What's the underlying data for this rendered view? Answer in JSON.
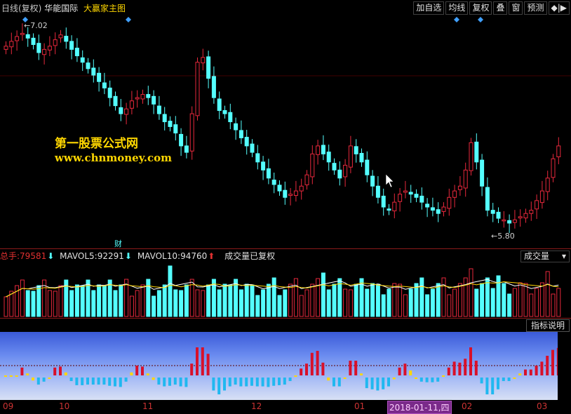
{
  "title": {
    "period": "日线(复权)",
    "stock": "华能国际",
    "indicator": "大赢家主图"
  },
  "toolbar": {
    "buttons": [
      "加自选",
      "均线",
      "复权",
      "叠",
      "窗",
      "预测",
      "◆|▶"
    ]
  },
  "price": {
    "high_label": "7.02",
    "low_label": "5.80",
    "marker": "财"
  },
  "watermark": {
    "line1": "第一股票公式网",
    "line2": "www.chnmoney.com"
  },
  "volume": {
    "total_label": "总手:",
    "total_value": "79581",
    "mavol5_label": "MAVOL5:",
    "mavol5_value": "92291",
    "mavol10_label": "MAVOL10:",
    "mavol10_value": "94760",
    "note": "成交量已复权",
    "dropdown": "成交量"
  },
  "indicator_button": "指标说明",
  "axis": {
    "labels": [
      "09",
      "10",
      "11",
      "12",
      "01",
      "02",
      "03"
    ],
    "cursor_date": "2018-01-11,四"
  },
  "colors": {
    "up": "#e8283c",
    "down": "#54ffff",
    "ma_white": "#ffffff",
    "ma_yellow": "#ffd700",
    "separator": "#8b1a1a"
  },
  "chart_data": {
    "type": "candlestick",
    "closes": [
      6.92,
      6.95,
      6.98,
      7.0,
      6.97,
      6.93,
      6.88,
      6.9,
      6.92,
      6.96,
      6.99,
      6.95,
      6.9,
      6.86,
      6.82,
      6.78,
      6.74,
      6.7,
      6.66,
      6.6,
      6.55,
      6.5,
      6.53,
      6.58,
      6.6,
      6.62,
      6.6,
      6.56,
      6.5,
      6.45,
      6.42,
      6.38,
      6.3,
      6.26,
      6.5,
      6.82,
      6.85,
      6.72,
      6.6,
      6.52,
      6.5,
      6.45,
      6.4,
      6.35,
      6.3,
      6.26,
      6.2,
      6.15,
      6.1,
      6.06,
      6.02,
      5.98,
      6.0,
      6.02,
      6.05,
      6.12,
      6.25,
      6.3,
      6.25,
      6.2,
      6.15,
      6.1,
      6.18,
      6.3,
      6.25,
      6.2,
      6.12,
      6.05,
      5.98,
      5.92,
      5.9,
      5.95,
      6.0,
      6.02,
      6.0,
      5.98,
      5.95,
      5.92,
      5.9,
      5.88,
      5.92,
      5.98,
      6.02,
      6.05,
      6.15,
      6.32,
      6.2,
      6.05,
      5.9,
      5.88,
      5.85,
      5.84,
      5.82,
      5.84,
      5.86,
      5.88,
      5.9,
      5.96,
      6.02,
      6.1,
      6.22,
      6.3
    ]
  }
}
